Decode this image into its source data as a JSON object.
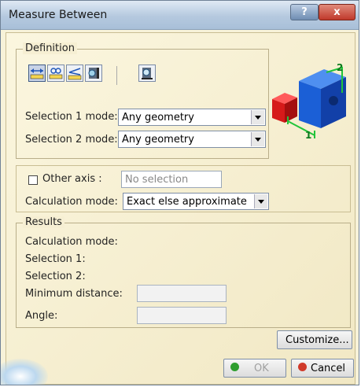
{
  "window": {
    "title": "Measure Between",
    "help_label": "?",
    "close_label": "x"
  },
  "definition": {
    "group_label": "Definition",
    "mode_icons": [
      "measure-between-icon",
      "measure-chain-icon",
      "measure-fan-icon",
      "measure-item-icon",
      "measure-thickness-icon"
    ],
    "selection1_label": "Selection 1 mode:",
    "selection1_value": "Any geometry",
    "selection2_label": "Selection 2 mode:",
    "selection2_value": "Any geometry",
    "preview_labels": [
      "1",
      "2"
    ],
    "preview_colors": {
      "cube_large": "#1b5fd6",
      "cube_small": "#d61a1a",
      "dimension": "#22c43a"
    }
  },
  "other_axis": {
    "label": "Other axis :",
    "checked": false,
    "placeholder": "No selection"
  },
  "calculation": {
    "label": "Calculation mode:",
    "value": "Exact else approximate"
  },
  "results": {
    "group_label": "Results",
    "calc_mode_label": "Calculation mode:",
    "sel1_label": "Selection 1:",
    "sel2_label": "Selection 2:",
    "min_distance_label": "Minimum distance:",
    "angle_label": "Angle:"
  },
  "buttons": {
    "customize": "Customize...",
    "ok": "OK",
    "cancel": "Cancel",
    "ok_color": "#2f9e2f",
    "cancel_color": "#d03a2a"
  }
}
